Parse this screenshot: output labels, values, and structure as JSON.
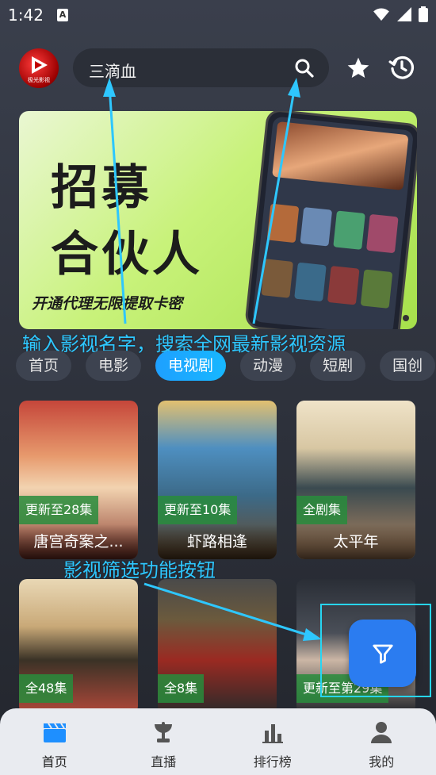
{
  "status_bar": {
    "time": "1:42",
    "notification": "A"
  },
  "header": {
    "logo_text": "极光影视",
    "search": {
      "value": "三滴血",
      "placeholder": ""
    }
  },
  "banner": {
    "title_line1": "招募",
    "title_line2": "合伙人",
    "subtitle": "开通代理无限提取卡密"
  },
  "annotations": {
    "search_hint": "输入影视名字，搜索全网最新影视资源",
    "filter_hint": "影视筛选功能按钮"
  },
  "tabs": [
    {
      "label": "首页",
      "active": false
    },
    {
      "label": "电影",
      "active": false
    },
    {
      "label": "电视剧",
      "active": true
    },
    {
      "label": "动漫",
      "active": false
    },
    {
      "label": "短剧",
      "active": false
    },
    {
      "label": "国创",
      "active": false
    }
  ],
  "cards": [
    {
      "badge": "更新至28集",
      "title": "唐宫奇案之..."
    },
    {
      "badge": "更新至10集",
      "title": "虾路相逢"
    },
    {
      "badge": "全剧集",
      "title": "太平年"
    },
    {
      "badge": "全48集",
      "title": ""
    },
    {
      "badge": "全8集",
      "title": ""
    },
    {
      "badge": "更新至第29集",
      "title": ""
    }
  ],
  "bottom_nav": [
    {
      "label": "首页",
      "icon": "clapperboard-icon",
      "active": true
    },
    {
      "label": "直播",
      "icon": "satellite-dish-icon",
      "active": false
    },
    {
      "label": "排行榜",
      "icon": "bar-chart-icon",
      "active": false
    },
    {
      "label": "我的",
      "icon": "user-icon",
      "active": false
    }
  ],
  "colors": {
    "accent": "#1ea0ff",
    "annotation": "#2ec7ff",
    "filter_button": "#2b7cf0",
    "badge": "#288c3c"
  }
}
